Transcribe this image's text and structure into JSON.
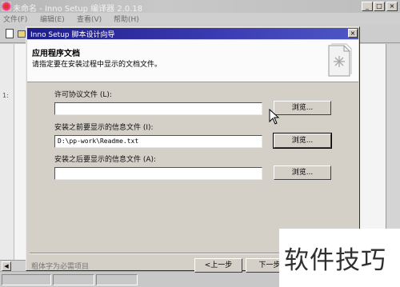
{
  "parent_window": {
    "title": "未命名 - Inno Setup 编译器 2.0.18",
    "icon": "inno-setup-app-icon",
    "controls": {
      "minimize": "_",
      "maximize": "□",
      "close": "×"
    },
    "menu": [
      "文件(F)",
      "编辑(E)",
      "查看(V)",
      "帮助(H)"
    ],
    "gutter_mark": "1:"
  },
  "dialog": {
    "title": "Inno Setup 脚本设计向导",
    "close_label": "×",
    "header": {
      "heading": "应用程序文档",
      "subheading": "请指定要在安装过程中显示的文档文件。",
      "icon": "document-wizard-icon"
    },
    "fields": {
      "license": {
        "label": "许可协议文件 (L):",
        "value": "",
        "browse_label": "浏览..."
      },
      "before_install": {
        "label": "安装之前要显示的信息文件 (I):",
        "value": "D:\\pp-work\\Readme.txt",
        "browse_label": "浏览..."
      },
      "after_install": {
        "label": "安装之后要显示的信息文件 (A):",
        "value": "",
        "browse_label": "浏览..."
      }
    },
    "footer_text": "粗体字为必需项目",
    "buttons": {
      "back": "<上一步",
      "next": "下一步"
    }
  },
  "watermark": {
    "text": "软件技巧"
  }
}
